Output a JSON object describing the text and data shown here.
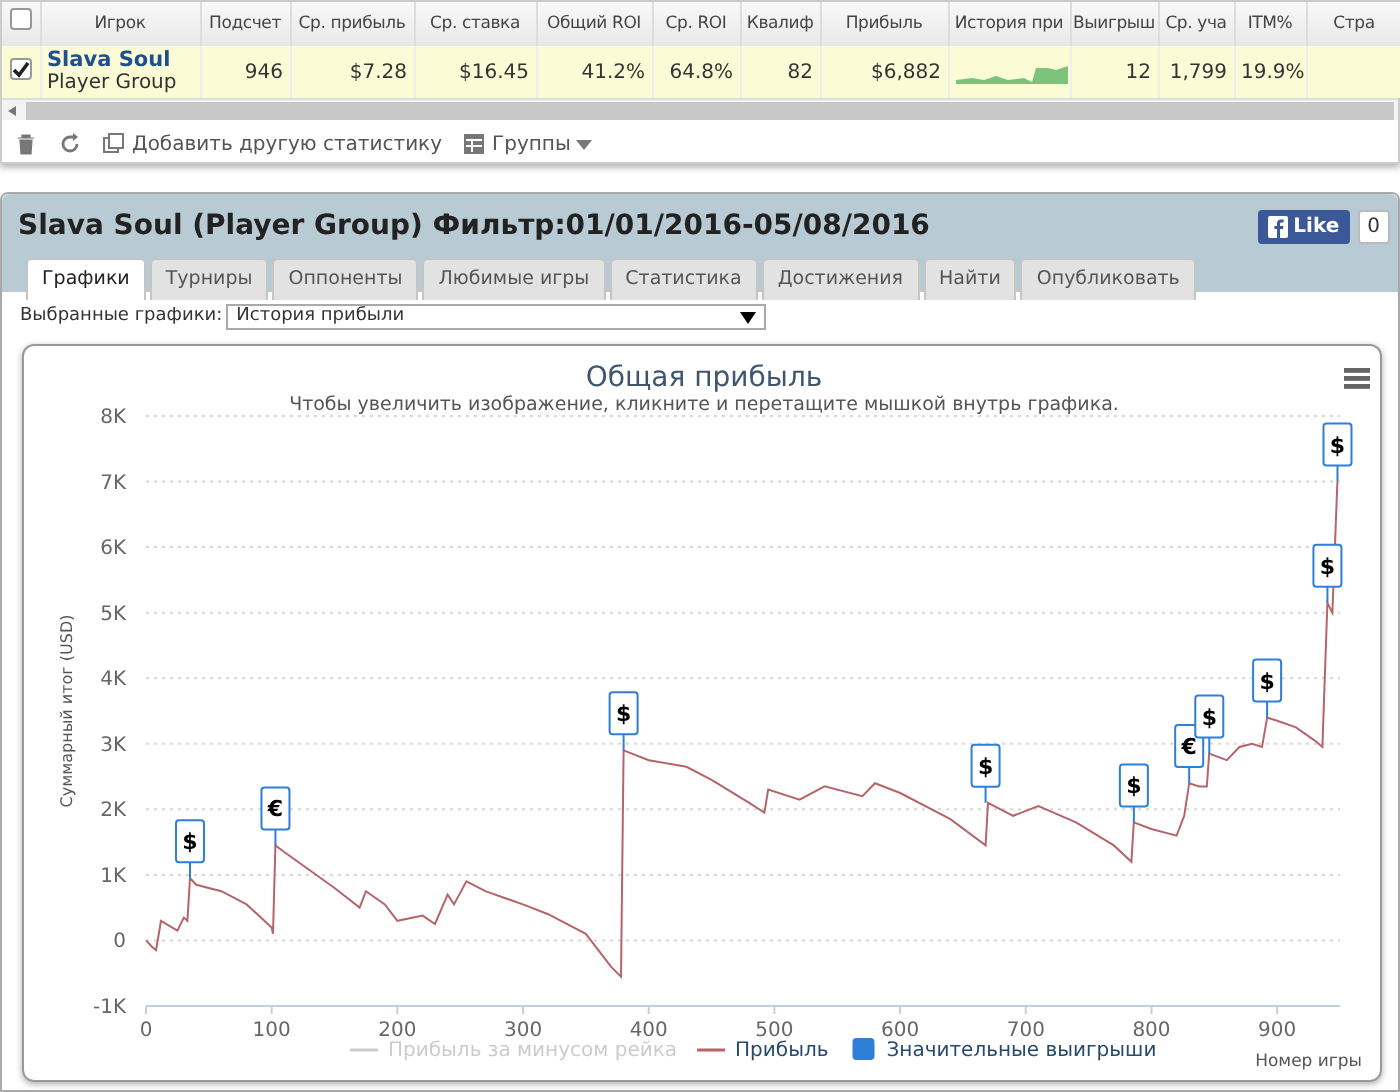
{
  "stats_table": {
    "header_checked": false,
    "columns": [
      "Игрок",
      "Подсчет",
      "Ср. прибыль",
      "Ср. ставка",
      "Общий ROI",
      "Ср. ROI",
      "Квалиф",
      "Прибыль",
      "История при",
      "Выигрыш",
      "Ср. уча",
      "ITM%",
      "Стра"
    ],
    "rows": [
      {
        "checked": true,
        "cells": [
          {
            "name": "Slava Soul",
            "group": "Player Group"
          },
          "946",
          "$7.28",
          "$16.45",
          "41.2%",
          "64.8%",
          "82",
          "$6,882",
          "",
          "12",
          "1,799",
          "19.9%",
          ""
        ]
      }
    ],
    "toolbar": [
      {
        "kind": "trash"
      },
      {
        "kind": "refresh"
      },
      {
        "kind": "add",
        "label": "Добавить другую статистику"
      },
      {
        "kind": "groups",
        "label": "Группы"
      }
    ]
  },
  "panel": {
    "title": "Slava Soul (Player Group) Фильтр:01/01/2016-05/08/2016",
    "like": {
      "label": "Like",
      "count": "0"
    },
    "tabs": [
      {
        "label": "Графики",
        "selected": true
      },
      {
        "label": "Турниры",
        "selected": false
      },
      {
        "label": "Оппоненты",
        "selected": false
      },
      {
        "label": "Любимые игры",
        "selected": false
      },
      {
        "label": "Статистика",
        "selected": false
      },
      {
        "label": "Достижения",
        "selected": false
      },
      {
        "label": "Найти",
        "selected": false
      },
      {
        "label": "Опубликовать",
        "selected": false
      }
    ],
    "chart_select": {
      "label": "Выбранные графики:",
      "value": "История прибыли"
    },
    "chart": {
      "legend": [
        {
          "label": "Прибыль за минусом рейка",
          "kind": "line",
          "visible": false
        },
        {
          "kind": "series",
          "visible": true
        },
        {
          "label": "Значительные выигрыши",
          "kind": "flag",
          "visible": true,
          "color": "#2f7ed8"
        }
      ],
      "chart_data": {
        "type": "line",
        "title": "Общая прибыль",
        "subtitle": "Чтобы увеличить изображение, кликните и перетащите мышкой внутрь графика.",
        "xlabel": "Номер игры",
        "ylabel": "Суммарный итог (USD)",
        "x": [
          0,
          5,
          8,
          12,
          25,
          30,
          33,
          35,
          40,
          60,
          80,
          100,
          101,
          103,
          110,
          150,
          170,
          175,
          190,
          200,
          220,
          230,
          240,
          245,
          255,
          270,
          300,
          320,
          350,
          370,
          378,
          380,
          400,
          430,
          450,
          480,
          492,
          495,
          520,
          540,
          570,
          580,
          600,
          640,
          668,
          670,
          690,
          710,
          740,
          770,
          784,
          786,
          800,
          820,
          826,
          830,
          838,
          844,
          846,
          860,
          870,
          880,
          888,
          892,
          900,
          915,
          930,
          936,
          940,
          944,
          948
        ],
        "series": [
          {
            "name": "Прибыль",
            "color": "#b5656a",
            "values": [
              0,
              -100,
              -150,
              300,
              150,
              350,
              300,
              950,
              850,
              750,
              550,
              200,
              100,
              1450,
              1350,
              800,
              500,
              750,
              550,
              300,
              380,
              250,
              700,
              550,
              900,
              750,
              550,
              400,
              100,
              -400,
              -550,
              2900,
              2750,
              2650,
              2450,
              2100,
              1950,
              2300,
              2150,
              2350,
              2200,
              2400,
              2250,
              1850,
              1450,
              2100,
              1900,
              2050,
              1800,
              1450,
              1200,
              1800,
              1700,
              1600,
              1900,
              2400,
              2350,
              2350,
              2850,
              2750,
              2950,
              3000,
              2950,
              3400,
              3350,
              3250,
              3050,
              2950,
              5150,
              5000,
              7000
            ]
          }
        ],
        "grid": true,
        "xlim": [
          0,
          950
        ],
        "ylim": [
          -1000,
          8000
        ],
        "xticks": [
          0,
          100,
          200,
          300,
          400,
          500,
          600,
          700,
          800,
          900
        ],
        "yticks": [
          {
            "value": -1000,
            "label": "-1K"
          },
          {
            "value": 0,
            "label": "0"
          },
          {
            "value": 1000,
            "label": "1K"
          },
          {
            "value": 2000,
            "label": "2K"
          },
          {
            "value": 3000,
            "label": "3K"
          },
          {
            "value": 4000,
            "label": "4K"
          },
          {
            "value": 5000,
            "label": "5K"
          },
          {
            "value": 6000,
            "label": "6K"
          },
          {
            "value": 7000,
            "label": "7K"
          },
          {
            "value": 8000,
            "label": "8K"
          }
        ],
        "annotations": [
          {
            "x": 35,
            "y": 950,
            "text": "$"
          },
          {
            "x": 103,
            "y": 1450,
            "text": "€"
          },
          {
            "x": 380,
            "y": 2900,
            "text": "$"
          },
          {
            "x": 668,
            "y": 2100,
            "text": "$"
          },
          {
            "x": 786,
            "y": 1800,
            "text": "$"
          },
          {
            "x": 830,
            "y": 2400,
            "text": "€"
          },
          {
            "x": 846,
            "y": 2850,
            "text": "$"
          },
          {
            "x": 892,
            "y": 3400,
            "text": "$"
          },
          {
            "x": 940,
            "y": 5150,
            "text": "$"
          },
          {
            "x": 948,
            "y": 7000,
            "text": "$"
          }
        ]
      }
    }
  }
}
